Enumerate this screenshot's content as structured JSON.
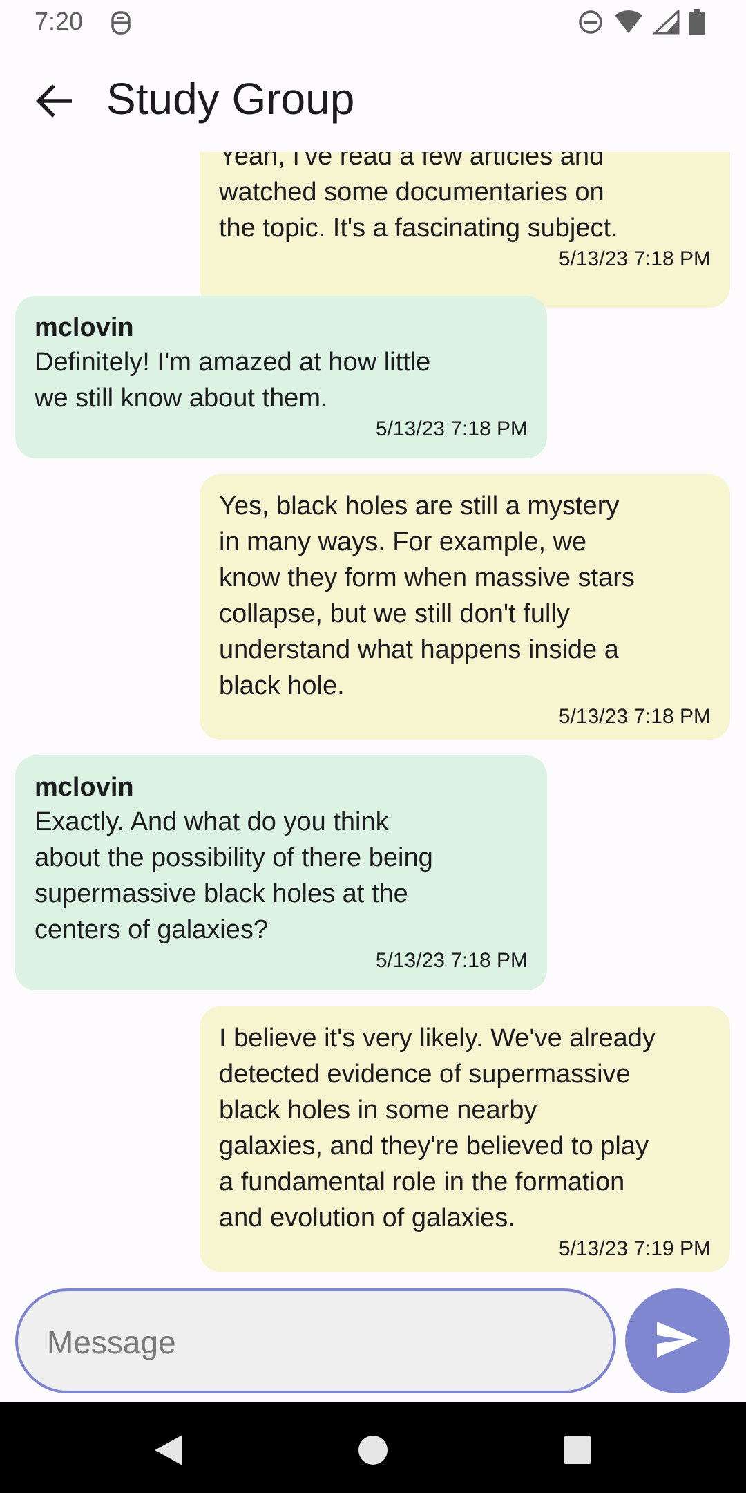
{
  "status_bar": {
    "time": "7:20",
    "icons": [
      "media-icon",
      "do-not-disturb-icon",
      "wifi-icon",
      "signal-icon",
      "battery-icon"
    ]
  },
  "app_bar": {
    "title": "Study Group",
    "back_icon": "arrow-back-icon"
  },
  "messages": [
    {
      "type": "sent",
      "text": "Yeah, I've read a few articles and\nwatched some documentaries on\nthe topic. It's a fascinating subject.",
      "time": "5/13/23 7:18 PM"
    },
    {
      "type": "received",
      "sender": "mclovin",
      "text": "Definitely! I'm amazed at how little\nwe still know about them.",
      "time": "5/13/23 7:18 PM"
    },
    {
      "type": "sent",
      "text": "Yes, black holes are still a mystery\nin many ways. For example, we\nknow they form when massive stars\ncollapse, but we still don't fully\nunderstand what happens inside a\nblack hole.",
      "time": "5/13/23 7:18 PM"
    },
    {
      "type": "received",
      "sender": "mclovin",
      "text": "Exactly. And what do you think\nabout the possibility of there being\nsupermassive black holes at the\ncenters of galaxies?",
      "time": "5/13/23 7:18 PM"
    },
    {
      "type": "sent",
      "text": "I believe it's very likely. We've already\ndetected evidence of supermassive\nblack holes in some nearby\ngalaxies, and they're believed to play\na fundamental role in the formation\nand evolution of galaxies.",
      "time": "5/13/23 7:19 PM"
    }
  ],
  "composer": {
    "placeholder": "Message",
    "value": "",
    "send_icon": "send-icon"
  },
  "nav_bar": {
    "icons": [
      "nav-back-icon",
      "home-icon",
      "recents-icon"
    ]
  },
  "colors": {
    "sent_bubble": "#f7f5d0",
    "received_bubble": "#dcf2e2",
    "accent": "#8087d1",
    "background": "#fefbff"
  }
}
